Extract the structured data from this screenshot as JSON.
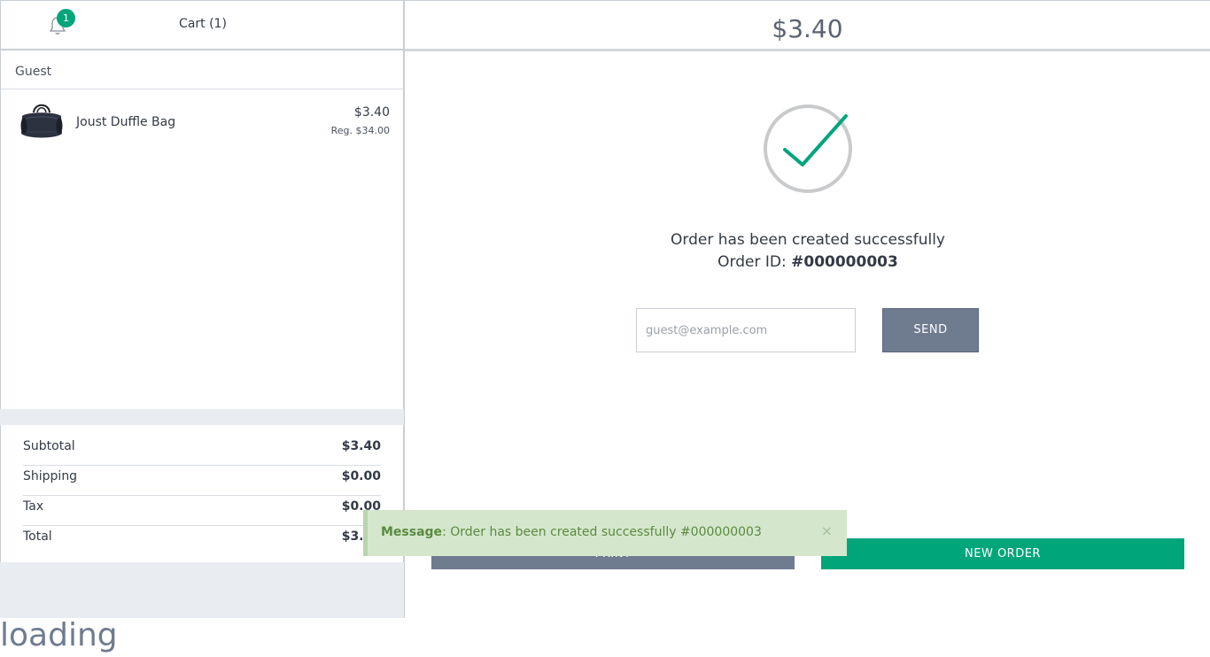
{
  "cart": {
    "notification_count": "1",
    "title": "Cart (1)",
    "customer": "Guest",
    "items": [
      {
        "name": "Joust Duffle Bag",
        "price": "$3.40",
        "regular_price": "Reg. $34.00"
      }
    ]
  },
  "totals": {
    "rows": [
      {
        "label": "Subtotal",
        "value": "$3.40"
      },
      {
        "label": "Shipping",
        "value": "$0.00"
      },
      {
        "label": "Tax",
        "value": "$0.00"
      },
      {
        "label": "Total",
        "value": "$3.40"
      }
    ]
  },
  "checkout": {
    "amount": "$3.40",
    "success_message": "Order has been created successfully",
    "order_id_label": "Order ID:",
    "order_id": "#000000003",
    "email_placeholder": "guest@example.com",
    "send_label": "SEND",
    "print_label": "PRINT",
    "new_order_label": "NEW ORDER"
  },
  "toast": {
    "prefix": "Message",
    "text": ": Order has been created successfully #000000003",
    "close": "×"
  },
  "loading_text": "loading",
  "colors": {
    "accent_green": "#00a57a",
    "button_gray": "#6f7b8f",
    "toast_bg": "#d4e7cd",
    "toast_text": "#5a8a3f"
  }
}
